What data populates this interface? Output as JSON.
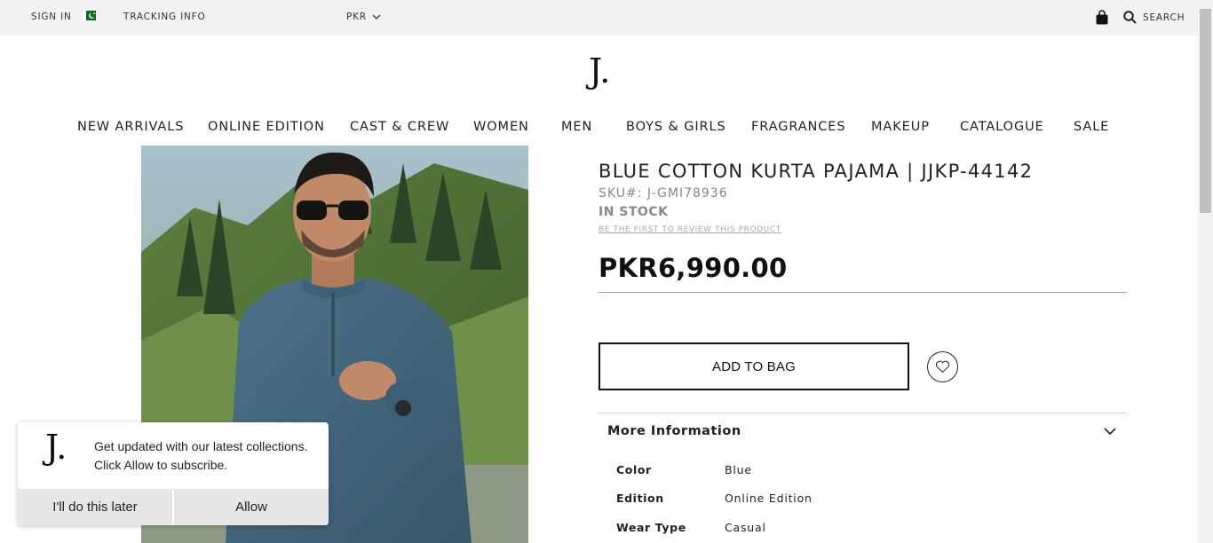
{
  "topbar": {
    "sign_in": "SIGN IN",
    "tracking": "TRACKING INFO",
    "currency": "PKR",
    "search": "SEARCH"
  },
  "icons": {
    "flag": "pakistan-flag-icon",
    "currency_dropdown": "chevron-down-icon",
    "bag": "shopping-bag-icon",
    "search": "search-icon",
    "wishlist": "heart-icon",
    "more_info": "chevron-down-icon"
  },
  "logo": "J.",
  "nav": [
    "NEW ARRIVALS",
    "ONLINE EDITION",
    "CAST & CREW",
    "WOMEN",
    "MEN",
    "BOYS & GIRLS",
    "FRAGRANCES",
    "MAKEUP",
    "CATALOGUE",
    "SALE"
  ],
  "product": {
    "title": "BLUE COTTON KURTA PAJAMA | JJKP-44142",
    "sku": "SKU#:  J-GMI78936",
    "stock": "IN STOCK",
    "review_link": "BE THE FIRST TO REVIEW THIS PRODUCT",
    "price": "PKR6,990.00",
    "add_to_bag": "ADD TO BAG",
    "more_info": "More Information",
    "attributes": [
      {
        "label": "Color",
        "value": "Blue"
      },
      {
        "label": "Edition",
        "value": "Online Edition"
      },
      {
        "label": "Wear Type",
        "value": "Casual"
      }
    ]
  },
  "popup": {
    "logo": "J.",
    "message_line1": "Get updated with our latest collections.",
    "message_line2": "Click Allow to subscribe.",
    "later": "I'll do this later",
    "allow": "Allow"
  },
  "colors": {
    "topbar_bg": "#f2f2f2",
    "text": "#222222",
    "muted": "#888888",
    "flag_green": "#0a6b1f"
  }
}
